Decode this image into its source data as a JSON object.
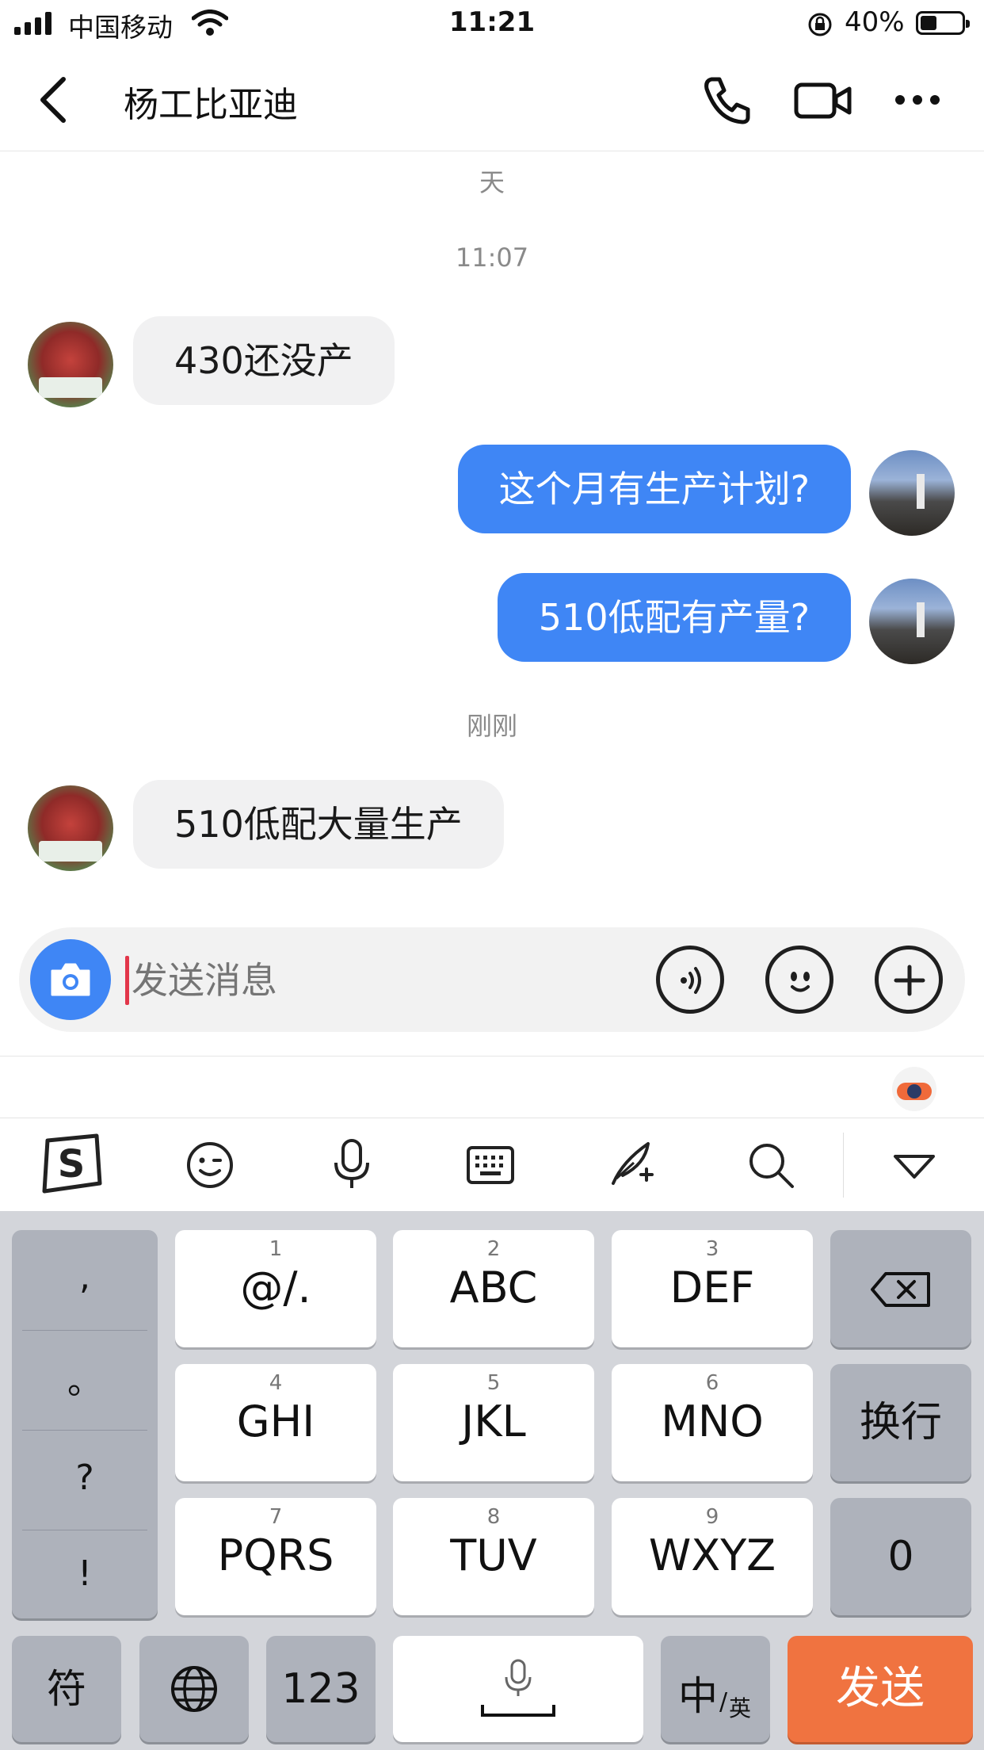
{
  "status_bar": {
    "carrier": "中国移动",
    "time": "11:21",
    "battery": "40%"
  },
  "header": {
    "title": "杨工比亚迪",
    "back_icon": "chevron-left-icon",
    "call_icon": "phone-icon",
    "video_icon": "video-camera-icon",
    "more_icon": "more-dots-icon"
  },
  "chat": {
    "top_partial_text": "天",
    "timestamps": [
      "11:07",
      "刚刚"
    ],
    "messages": [
      {
        "from": "contact",
        "text": "430还没产"
      },
      {
        "from": "me",
        "text": "这个月有生产计划?"
      },
      {
        "from": "me",
        "text": "510低配有产量?"
      },
      {
        "from": "contact",
        "text": "510低配大量生产"
      }
    ]
  },
  "input": {
    "placeholder": "发送消息",
    "camera_icon": "camera-icon",
    "voice_icon": "voice-icon",
    "emoji_icon": "emoji-icon",
    "plus_icon": "plus-icon"
  },
  "ime_toolbar": {
    "icons": [
      "sogou-logo-icon",
      "emoji-icon",
      "microphone-icon",
      "keyboard-icon",
      "handwriting-icon",
      "search-icon",
      "collapse-triangle-icon"
    ]
  },
  "keyboard": {
    "punct": [
      ",",
      "。",
      "?",
      "!"
    ],
    "keys": [
      {
        "num": "1",
        "label": "@/."
      },
      {
        "num": "2",
        "label": "ABC"
      },
      {
        "num": "3",
        "label": "DEF"
      },
      {
        "num": "4",
        "label": "GHI"
      },
      {
        "num": "5",
        "label": "JKL"
      },
      {
        "num": "6",
        "label": "MNO"
      },
      {
        "num": "7",
        "label": "PQRS"
      },
      {
        "num": "8",
        "label": "TUV"
      },
      {
        "num": "9",
        "label": "WXYZ"
      }
    ],
    "newline_label": "换行",
    "zero_label": "0",
    "symbol_label": "符",
    "num_label": "123",
    "lang_main": "中",
    "lang_sub": "英",
    "send_label": "发送",
    "send_color": "#f07340"
  }
}
